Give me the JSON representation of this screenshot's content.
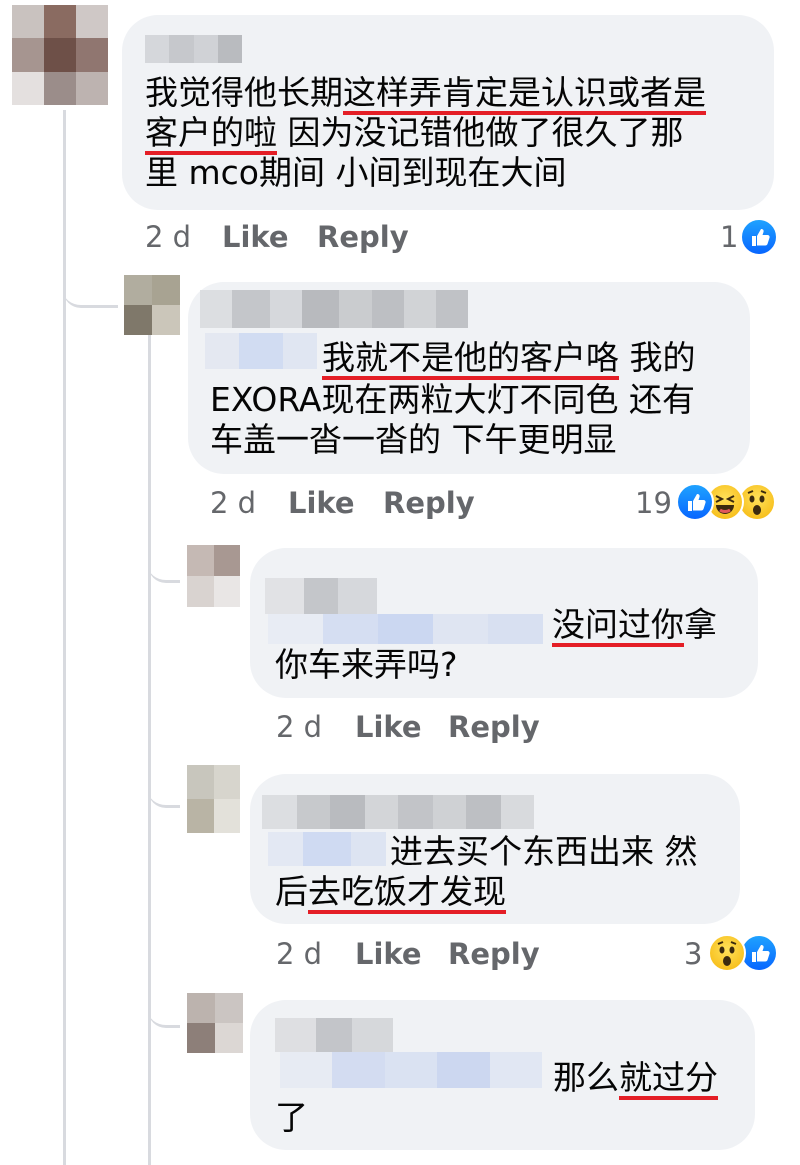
{
  "comments": [
    {
      "text_lines": [
        [
          "我觉得他长期",
          "这样弄肯定是认识或者是"
        ],
        [
          "客户的啦",
          " 因为没记错他做了很久了那"
        ],
        [
          "里 mco期间 小间到现在大间"
        ]
      ],
      "time": "2 d",
      "like": "Like",
      "reply": "Reply",
      "reaction_count": "1"
    },
    {
      "text_lines": [
        [
          "我就不是他的客户咯",
          " 我的"
        ],
        [
          "EXORA现在两粒大灯不同色 还有"
        ],
        [
          "车盖一沓一沓的 下午更明显"
        ]
      ],
      "time": "2 d",
      "like": "Like",
      "reply": "Reply",
      "reaction_count": "19"
    },
    {
      "text_lines": [
        [
          "没问过你",
          "拿"
        ],
        [
          "你车来弄吗?"
        ]
      ],
      "time": "2 d",
      "like": "Like",
      "reply": "Reply"
    },
    {
      "text_lines": [
        [
          "进去买个东西出来 然"
        ],
        [
          "后",
          "去吃饭才发现"
        ]
      ],
      "time": "2 d",
      "like": "Like",
      "reply": "Reply",
      "reaction_count": "3"
    },
    {
      "text_lines": [
        [
          "那么",
          "就过分"
        ],
        [
          "了"
        ]
      ]
    }
  ],
  "icons": {
    "like": "like-reaction-icon",
    "haha": "haha-reaction-icon",
    "wow": "wow-reaction-icon"
  },
  "colors": {
    "bubble": "#f0f2f5",
    "action_text": "#65676b",
    "underline": "#e41e26",
    "like_blue": "#0866ff"
  }
}
